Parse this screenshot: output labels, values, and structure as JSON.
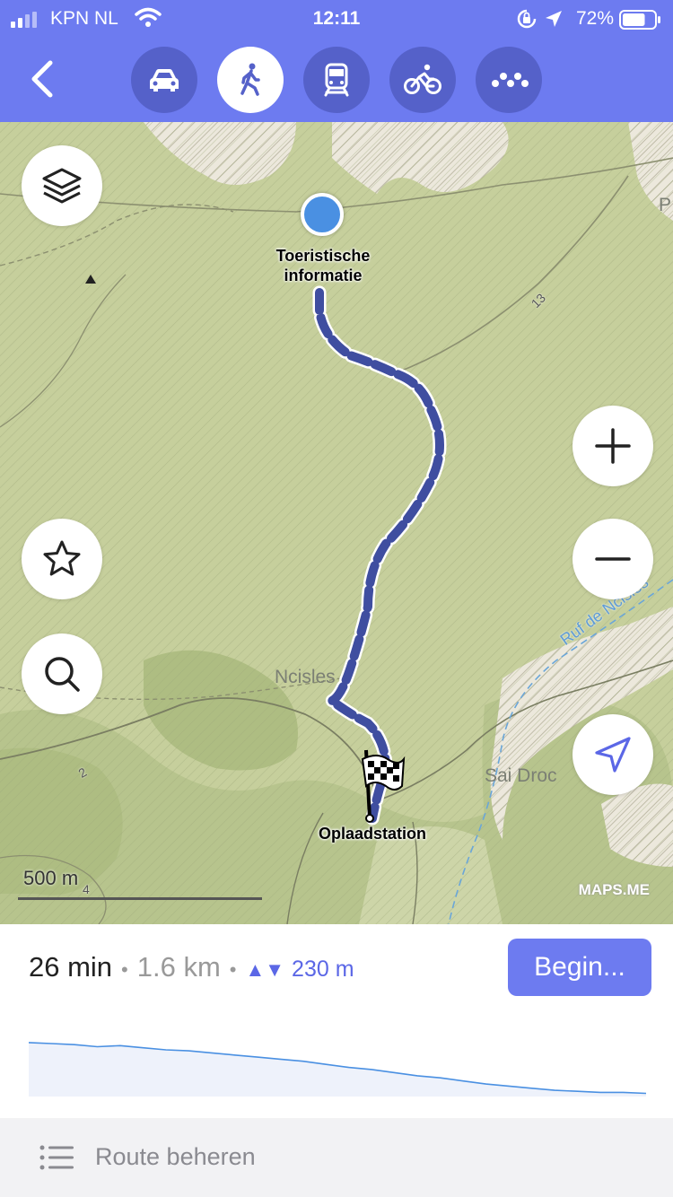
{
  "status_bar": {
    "carrier": "KPN NL",
    "time": "12:11",
    "battery_percent": "72%",
    "battery_level": 0.72
  },
  "header": {
    "back_icon": "chevron-left-icon",
    "modes": [
      {
        "id": "car",
        "icon": "car-icon",
        "active": false
      },
      {
        "id": "walk",
        "icon": "pedestrian-icon",
        "active": true
      },
      {
        "id": "transit",
        "icon": "train-icon",
        "active": false
      },
      {
        "id": "bike",
        "icon": "bicycle-icon",
        "active": false
      },
      {
        "id": "more",
        "icon": "more-icon",
        "active": false
      }
    ],
    "accent_color": "#6d7bf0"
  },
  "map": {
    "start_label_line1": "Toeristische",
    "start_label_line2": "informatie",
    "end_label": "Oplaadstation",
    "place_labels": {
      "ncisles": "Ncisles",
      "sai_droc": "Sai Droc",
      "river": "Ruf de Ncisles",
      "road_13": "13",
      "road_2": "2",
      "road_4": "4",
      "edge_p": "P"
    },
    "scale": "500 m",
    "watermark": "MAPS.ME",
    "route_color": "#3f4ea0"
  },
  "summary": {
    "duration": "26 min",
    "distance": "1.6 km",
    "elevation": "230 m",
    "start_button": "Begin..."
  },
  "elevation_profile": [
    12,
    13,
    14,
    16,
    15,
    17,
    19,
    20,
    22,
    24,
    26,
    28,
    30,
    33,
    36,
    38,
    41,
    44,
    46,
    49,
    52,
    54,
    56,
    58,
    59,
    60,
    60,
    61
  ],
  "footer": {
    "manage_label": "Route beheren"
  }
}
